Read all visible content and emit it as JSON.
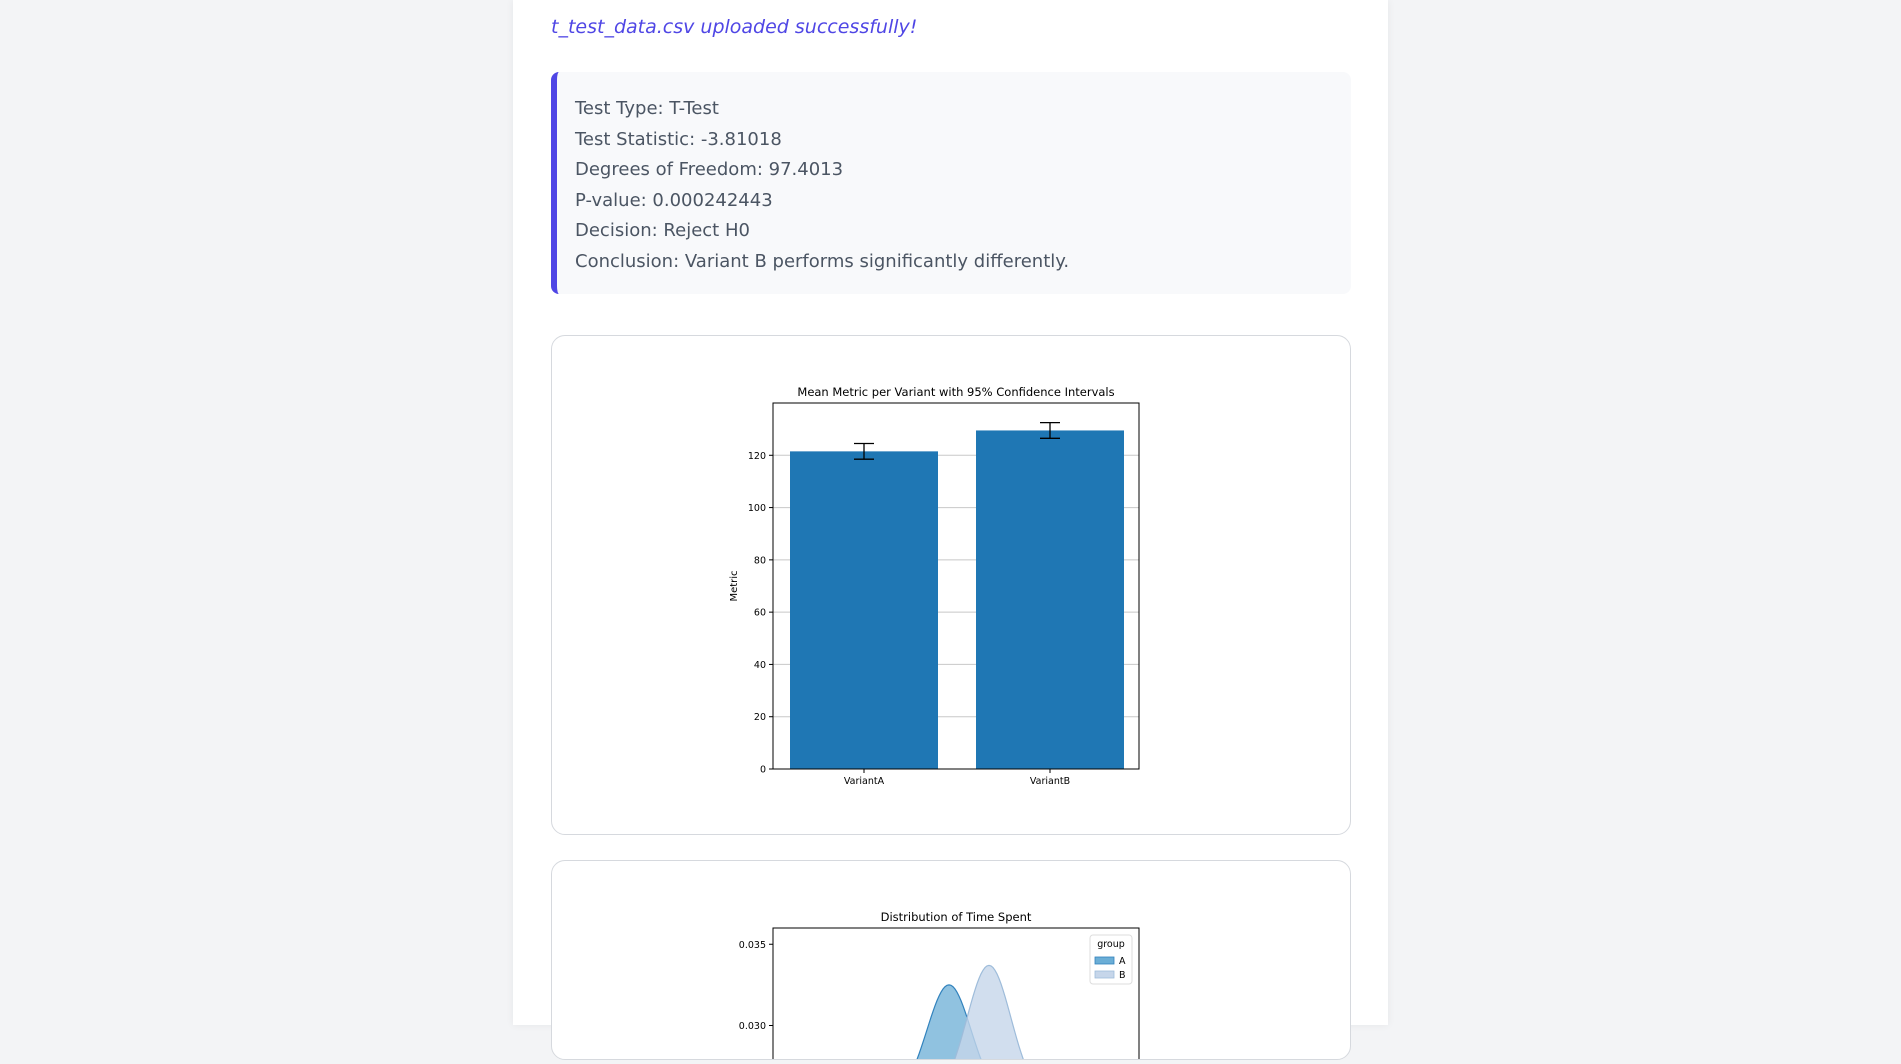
{
  "upload": {
    "message": "t_test_data.csv uploaded successfully!"
  },
  "results": {
    "lines": [
      "Test Type: T-Test",
      "Test Statistic: -3.81018",
      "Degrees of Freedom: 97.4013",
      "P-value: 0.000242443",
      "Decision: Reject H0",
      "Conclusion: Variant B performs significantly differently."
    ]
  },
  "colors": {
    "accent": "#4f46e5",
    "bar": "#1f77b4",
    "kde_a": "#6baed6",
    "kde_b": "#c6d6ea"
  },
  "chart_data": [
    {
      "type": "bar",
      "title": "Mean Metric per Variant with 95% Confidence Intervals",
      "ylabel": "Metric",
      "xlabel": "",
      "categories": [
        "VariantA",
        "VariantB"
      ],
      "values": [
        121.5,
        129.5
      ],
      "ci_low": [
        118.5,
        126.5
      ],
      "ci_high": [
        124.5,
        132.5
      ],
      "ylim": [
        0,
        140
      ],
      "yticks": [
        0,
        20,
        40,
        60,
        80,
        100,
        120
      ],
      "grid": "y"
    },
    {
      "type": "area",
      "title": "Distribution of Time Spent",
      "legend_title": "group",
      "legend_placement": "top-right",
      "series": [
        {
          "name": "A",
          "mean": 0,
          "peak": 0.0325
        },
        {
          "name": "B",
          "mean": 0,
          "peak": 0.0337
        }
      ],
      "yticks": [
        0.03,
        0.035
      ],
      "ytick_labels": [
        "0.030",
        "0.035"
      ]
    }
  ]
}
